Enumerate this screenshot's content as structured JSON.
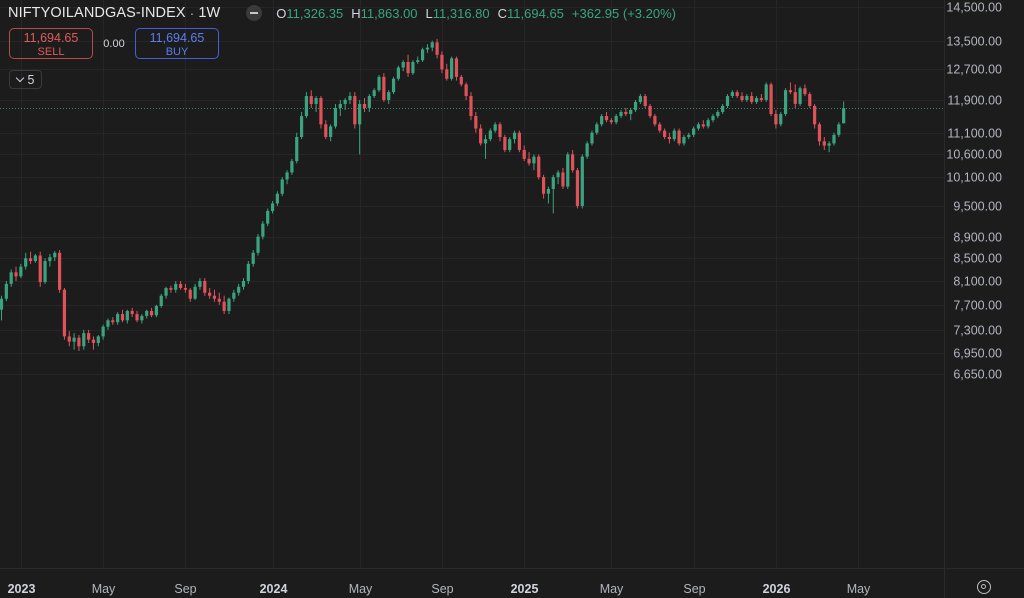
{
  "header": {
    "symbol": "NIFTYOILANDGAS-INDEX",
    "separator": "·",
    "interval": "1W",
    "open_label": "O",
    "open": "11,326.35",
    "high_label": "H",
    "high": "11,863.00",
    "low_label": "L",
    "low": "11,316.80",
    "close_label": "C",
    "close": "11,694.65",
    "change": "+362.95 (+3.20%)"
  },
  "trade": {
    "sell_price": "11,694.65",
    "sell_label": "SELL",
    "spread": "0.00",
    "buy_price": "11,694.65",
    "buy_label": "BUY"
  },
  "indicator_count": "5",
  "colors": {
    "up": "#3aa47f",
    "down": "#e0525a",
    "background": "#1c1c1c",
    "grid": "#262626",
    "last_price_line": "#3aa47f"
  },
  "icons": [
    "eye-icon",
    "chevron-down-icon",
    "settings-icon"
  ],
  "chart_data": {
    "type": "candlestick",
    "title": "NIFTYOILANDGAS-INDEX · 1W",
    "scale": "log",
    "ylim": [
      6500,
      14600
    ],
    "y_ticks": [
      "14,500.00",
      "13,500.00",
      "12,700.00",
      "11,900.00",
      "11,100.00",
      "10,600.00",
      "10,100.00",
      "9,500.00",
      "8,900.00",
      "8,500.00",
      "8,100.00",
      "7,700.00",
      "7,300.00",
      "6,950.00",
      "6,650.00"
    ],
    "x_ticks": [
      {
        "label": "2023",
        "bold": true,
        "week": 4
      },
      {
        "label": "May",
        "bold": false,
        "week": 21
      },
      {
        "label": "Sep",
        "bold": false,
        "week": 38
      },
      {
        "label": "2024",
        "bold": true,
        "week": 56
      },
      {
        "label": "May",
        "bold": false,
        "week": 74
      },
      {
        "label": "Sep",
        "bold": false,
        "week": 91
      },
      {
        "label": "2025",
        "bold": true,
        "week": 108
      },
      {
        "label": "May",
        "bold": false,
        "week": 126
      },
      {
        "label": "Sep",
        "bold": false,
        "week": 143
      },
      {
        "label": "2026",
        "bold": true,
        "week": 160
      },
      {
        "label": "May",
        "bold": false,
        "week": 177
      }
    ],
    "last_price": 11694.65,
    "candles": [
      [
        7620,
        7850,
        7450,
        7800
      ],
      [
        7800,
        8100,
        7760,
        8050
      ],
      [
        8050,
        8300,
        8000,
        8250
      ],
      [
        8250,
        8350,
        8100,
        8180
      ],
      [
        8180,
        8400,
        8150,
        8350
      ],
      [
        8350,
        8600,
        8300,
        8500
      ],
      [
        8500,
        8620,
        8400,
        8450
      ],
      [
        8450,
        8580,
        8420,
        8550
      ],
      [
        8550,
        8620,
        8000,
        8080
      ],
      [
        8080,
        8500,
        8050,
        8450
      ],
      [
        8450,
        8580,
        8350,
        8520
      ],
      [
        8520,
        8630,
        8450,
        8600
      ],
      [
        8600,
        8650,
        7900,
        7950
      ],
      [
        7950,
        7980,
        7150,
        7200
      ],
      [
        7200,
        7280,
        7050,
        7120
      ],
      [
        7120,
        7250,
        7000,
        7180
      ],
      [
        7180,
        7220,
        6980,
        7050
      ],
      [
        7050,
        7300,
        7000,
        7250
      ],
      [
        7250,
        7300,
        7100,
        7150
      ],
      [
        7150,
        7200,
        7000,
        7100
      ],
      [
        7100,
        7220,
        7050,
        7200
      ],
      [
        7200,
        7380,
        7150,
        7350
      ],
      [
        7350,
        7480,
        7300,
        7450
      ],
      [
        7450,
        7500,
        7380,
        7420
      ],
      [
        7420,
        7580,
        7380,
        7550
      ],
      [
        7550,
        7620,
        7420,
        7450
      ],
      [
        7450,
        7620,
        7400,
        7600
      ],
      [
        7600,
        7650,
        7500,
        7550
      ],
      [
        7550,
        7600,
        7420,
        7450
      ],
      [
        7450,
        7550,
        7400,
        7520
      ],
      [
        7520,
        7620,
        7480,
        7600
      ],
      [
        7600,
        7650,
        7500,
        7530
      ],
      [
        7530,
        7700,
        7500,
        7680
      ],
      [
        7680,
        7880,
        7650,
        7850
      ],
      [
        7850,
        8000,
        7800,
        7980
      ],
      [
        7980,
        8020,
        7900,
        7950
      ],
      [
        7950,
        8100,
        7900,
        8050
      ],
      [
        8050,
        8100,
        7950,
        7980
      ],
      [
        7980,
        8050,
        7900,
        7950
      ],
      [
        7950,
        7980,
        7750,
        7800
      ],
      [
        7800,
        8050,
        7780,
        8000
      ],
      [
        8000,
        8150,
        7950,
        8100
      ],
      [
        8100,
        8150,
        7850,
        7900
      ],
      [
        7900,
        7980,
        7800,
        7850
      ],
      [
        7850,
        7950,
        7750,
        7800
      ],
      [
        7800,
        7900,
        7700,
        7750
      ],
      [
        7750,
        7850,
        7550,
        7600
      ],
      [
        7600,
        7820,
        7550,
        7800
      ],
      [
        7800,
        7950,
        7750,
        7900
      ],
      [
        7900,
        8050,
        7850,
        8000
      ],
      [
        8000,
        8150,
        7950,
        8100
      ],
      [
        8100,
        8450,
        8050,
        8400
      ],
      [
        8400,
        8650,
        8350,
        8600
      ],
      [
        8600,
        8950,
        8550,
        8900
      ],
      [
        8900,
        9200,
        8850,
        9150
      ],
      [
        9150,
        9450,
        9100,
        9400
      ],
      [
        9400,
        9600,
        9350,
        9550
      ],
      [
        9550,
        9800,
        9500,
        9750
      ],
      [
        9750,
        10100,
        9700,
        10050
      ],
      [
        10050,
        10250,
        9950,
        10200
      ],
      [
        10200,
        10500,
        10150,
        10450
      ],
      [
        10450,
        11100,
        10400,
        11000
      ],
      [
        11000,
        11600,
        10950,
        11500
      ],
      [
        11500,
        12100,
        11450,
        12000
      ],
      [
        12000,
        12150,
        11700,
        11800
      ],
      [
        11800,
        12000,
        11600,
        11950
      ],
      [
        11950,
        12000,
        11200,
        11300
      ],
      [
        11300,
        11400,
        10950,
        11000
      ],
      [
        11000,
        11300,
        10900,
        11250
      ],
      [
        11250,
        11800,
        11200,
        11700
      ],
      [
        11700,
        11900,
        11500,
        11800
      ],
      [
        11800,
        11950,
        11650,
        11900
      ],
      [
        11900,
        12100,
        11800,
        12000
      ],
      [
        12000,
        12100,
        11200,
        11300
      ],
      [
        11300,
        11900,
        10600,
        11800
      ],
      [
        11800,
        11950,
        11600,
        11700
      ],
      [
        11700,
        12050,
        11600,
        12000
      ],
      [
        12000,
        12200,
        11950,
        12150
      ],
      [
        12150,
        12550,
        12100,
        12500
      ],
      [
        12500,
        12600,
        11850,
        11900
      ],
      [
        11900,
        12150,
        11800,
        12100
      ],
      [
        12100,
        12500,
        12050,
        12450
      ],
      [
        12450,
        12800,
        12400,
        12750
      ],
      [
        12750,
        12950,
        12650,
        12900
      ],
      [
        12900,
        13100,
        12500,
        12600
      ],
      [
        12600,
        12950,
        12550,
        12900
      ],
      [
        12900,
        13050,
        12850,
        12950
      ],
      [
        12950,
        13300,
        12900,
        13250
      ],
      [
        13250,
        13400,
        13150,
        13300
      ],
      [
        13300,
        13500,
        13200,
        13450
      ],
      [
        13450,
        13550,
        13000,
        13100
      ],
      [
        13100,
        13200,
        12600,
        12700
      ],
      [
        12700,
        12850,
        12400,
        12450
      ],
      [
        12450,
        13050,
        12400,
        13000
      ],
      [
        13000,
        13050,
        12400,
        12500
      ],
      [
        12500,
        12550,
        12250,
        12300
      ],
      [
        12300,
        12350,
        11900,
        12000
      ],
      [
        12000,
        12100,
        11400,
        11500
      ],
      [
        11500,
        11600,
        11100,
        11200
      ],
      [
        11200,
        11300,
        10800,
        10850
      ],
      [
        10850,
        11050,
        10500,
        10950
      ],
      [
        10950,
        11200,
        10900,
        11150
      ],
      [
        11150,
        11350,
        11100,
        11300
      ],
      [
        11300,
        11350,
        10900,
        11000
      ],
      [
        11000,
        11050,
        10650,
        10700
      ],
      [
        10700,
        11000,
        10650,
        10950
      ],
      [
        10950,
        11150,
        10850,
        11100
      ],
      [
        11100,
        11150,
        10650,
        10700
      ],
      [
        10700,
        10800,
        10450,
        10500
      ],
      [
        10500,
        10650,
        10350,
        10400
      ],
      [
        10400,
        10600,
        10250,
        10550
      ],
      [
        10550,
        10600,
        10050,
        10100
      ],
      [
        10100,
        10150,
        9650,
        9750
      ],
      [
        9750,
        9900,
        9550,
        9850
      ],
      [
        9850,
        10150,
        9350,
        10100
      ],
      [
        10100,
        10250,
        9950,
        10200
      ],
      [
        10200,
        10300,
        9850,
        9900
      ],
      [
        9900,
        10650,
        9850,
        10600
      ],
      [
        10600,
        10700,
        10200,
        10250
      ],
      [
        10250,
        10300,
        9450,
        9500
      ],
      [
        9500,
        10600,
        9450,
        10550
      ],
      [
        10550,
        10900,
        10500,
        10850
      ],
      [
        10850,
        11150,
        10800,
        11100
      ],
      [
        11100,
        11350,
        11050,
        11300
      ],
      [
        11300,
        11550,
        11250,
        11500
      ],
      [
        11500,
        11600,
        11350,
        11400
      ],
      [
        11400,
        11450,
        11300,
        11350
      ],
      [
        11350,
        11550,
        11300,
        11500
      ],
      [
        11500,
        11650,
        11450,
        11600
      ],
      [
        11600,
        11700,
        11500,
        11550
      ],
      [
        11550,
        11700,
        11400,
        11650
      ],
      [
        11650,
        11900,
        11600,
        11850
      ],
      [
        11850,
        12050,
        11800,
        12000
      ],
      [
        12000,
        12050,
        11700,
        11750
      ],
      [
        11750,
        11800,
        11450,
        11500
      ],
      [
        11500,
        11550,
        11250,
        11300
      ],
      [
        11300,
        11350,
        11100,
        11150
      ],
      [
        11150,
        11200,
        10950,
        11000
      ],
      [
        11000,
        11100,
        10850,
        10950
      ],
      [
        10950,
        11200,
        10900,
        11150
      ],
      [
        11150,
        11200,
        10800,
        10850
      ],
      [
        10850,
        11050,
        10800,
        11000
      ],
      [
        11000,
        11100,
        10950,
        11050
      ],
      [
        11050,
        11250,
        11000,
        11200
      ],
      [
        11200,
        11350,
        11150,
        11300
      ],
      [
        11300,
        11400,
        11200,
        11250
      ],
      [
        11250,
        11450,
        11200,
        11400
      ],
      [
        11400,
        11550,
        11350,
        11500
      ],
      [
        11500,
        11650,
        11450,
        11600
      ],
      [
        11600,
        11800,
        11550,
        11750
      ],
      [
        11750,
        12050,
        11700,
        12000
      ],
      [
        12000,
        12150,
        11950,
        12100
      ],
      [
        12100,
        12150,
        11950,
        12000
      ],
      [
        12000,
        12100,
        11850,
        11900
      ],
      [
        11900,
        12050,
        11850,
        12000
      ],
      [
        12000,
        12100,
        11800,
        11850
      ],
      [
        11850,
        12000,
        11800,
        11950
      ],
      [
        11950,
        12050,
        11850,
        11900
      ],
      [
        11900,
        12350,
        11850,
        12300
      ],
      [
        12300,
        12350,
        11500,
        11550
      ],
      [
        11550,
        11650,
        11200,
        11300
      ],
      [
        11300,
        11600,
        11250,
        11550
      ],
      [
        11550,
        12200,
        11500,
        12150
      ],
      [
        12150,
        12350,
        12050,
        12100
      ],
      [
        12100,
        12300,
        11700,
        11800
      ],
      [
        11800,
        12250,
        11750,
        12200
      ],
      [
        12200,
        12300,
        12000,
        12050
      ],
      [
        12050,
        12100,
        11700,
        11750
      ],
      [
        11750,
        11800,
        11200,
        11300
      ],
      [
        11300,
        11350,
        10800,
        10900
      ],
      [
        10900,
        11000,
        10700,
        10800
      ],
      [
        10800,
        10900,
        10650,
        10850
      ],
      [
        10850,
        11100,
        10800,
        11050
      ],
      [
        11050,
        11350,
        11000,
        11300
      ],
      [
        11326.35,
        11863,
        11316.8,
        11694.65
      ]
    ]
  }
}
